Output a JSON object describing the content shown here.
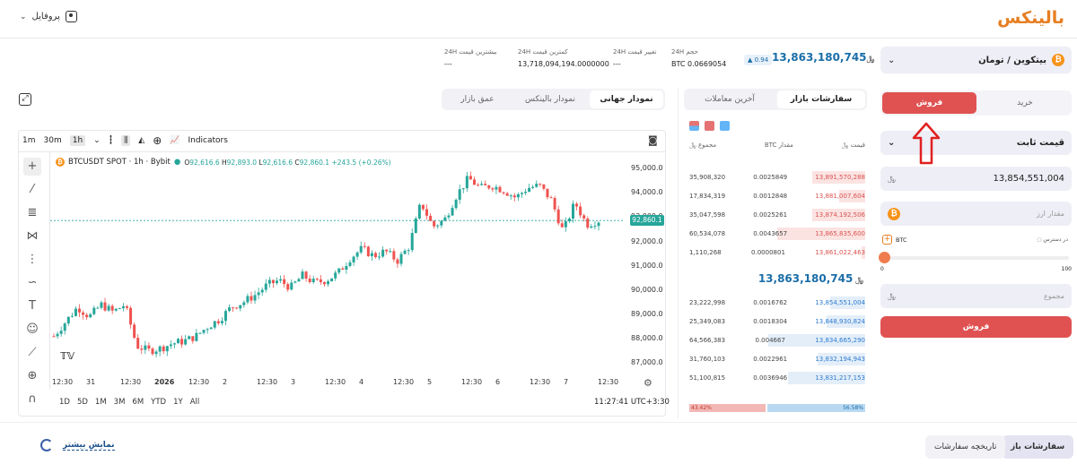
{
  "header": {
    "logo": "بالینکس",
    "profile": "پروفایل"
  },
  "colors": {
    "brand": "#e67e22",
    "sell": "#e05252",
    "buy_blue": "#2c7bd0",
    "positive": "#26a69a"
  },
  "market": {
    "pair": "بیتکوین / تومان",
    "last_price": "13,863,180,745",
    "change": "0.94",
    "stats": [
      {
        "label": "حجم 24H",
        "value": "BTC 0.0669054"
      },
      {
        "label": "تغییر قیمت 24H",
        "value": "---"
      },
      {
        "label": "کمترین قیمت 24H",
        "value": "13,718,094,194.0000000"
      },
      {
        "label": "بیشترین قیمت 24H",
        "value": "---"
      }
    ]
  },
  "trade": {
    "buy_tab": "خرید",
    "sell_tab": "فروش",
    "order_type": "قیمت ثابت",
    "price_value": "13,854,551,004",
    "amount_placeholder": "مقدار ارز",
    "available_label": "در دسترس",
    "asset": "BTC",
    "slider_min": "0",
    "slider_max": "100",
    "total_placeholder": "مجموع",
    "submit": "فروش"
  },
  "chart_tabs": [
    "نمودار جهانی",
    "نمودار بالینکس",
    "عمق بازار"
  ],
  "chart_toolbar": {
    "tf1": "1m",
    "tf2": "30m",
    "tf3": "1h",
    "indicators": "Indicators"
  },
  "chart_legend": {
    "symbol": "BTCUSDT SPOT · 1h · Bybit",
    "o": "92,616.6",
    "h": "92,893.0",
    "l": "92,616.6",
    "c": "92,860.1",
    "chg": "+243.5 (+0.26%)",
    "last_label": "92,860.1"
  },
  "chart_data": {
    "type": "candlestick",
    "title": "BTCUSDT SPOT · 1h · Bybit",
    "y_ticks": [
      "95,000.0",
      "94,000.0",
      "93,000.0",
      "92,000.0",
      "91,000.0",
      "90,000.0",
      "89,000.0",
      "88,000.0",
      "87,000.0"
    ],
    "ylim": [
      86600,
      95300
    ],
    "x_ticks": [
      "12:30",
      "31",
      "12:30",
      "2026",
      "12:30",
      "2",
      "12:30",
      "3",
      "12:30",
      "4",
      "12:30",
      "5",
      "12:30",
      "6",
      "12:30",
      "7",
      "12:30"
    ],
    "close_path": [
      88100,
      88700,
      89300,
      88900,
      89400,
      89100,
      89400,
      87700,
      87500,
      87600,
      87800,
      87900,
      88100,
      88500,
      88800,
      89300,
      89500,
      89800,
      90200,
      90400,
      90100,
      90600,
      90300,
      90400,
      90700,
      91300,
      91700,
      91400,
      91600,
      91200,
      91800,
      93600,
      92600,
      92900,
      93900,
      94600,
      94200,
      94300,
      94100,
      93800,
      94200,
      94300,
      93700,
      92400,
      93600,
      92700,
      92860
    ],
    "last_value": 92860.1
  },
  "chart_bottom": {
    "ranges": [
      "1D",
      "5D",
      "1M",
      "3M",
      "6M",
      "YTD",
      "1Y",
      "All"
    ],
    "time": "11:27:41 UTC+3:30"
  },
  "orderbook": {
    "tab_market": "سفارشات بازار",
    "tab_trades": "آخرین معاملات",
    "col_price": "قیمت",
    "col_amount": "مقدار",
    "col_amount_unit": "BTC",
    "col_total": "مجموع",
    "asks": [
      {
        "total": "35,908,320",
        "amount": "0.0025849",
        "price": "13,891,570,288",
        "fill": 0.3
      },
      {
        "total": "17,834,319",
        "amount": "0.0012848",
        "price": "13,881,007,604",
        "fill": 0.15
      },
      {
        "total": "35,047,598",
        "amount": "0.0025261",
        "price": "13,874,192,506",
        "fill": 0.3
      },
      {
        "total": "60,534,078",
        "amount": "0.0043657",
        "price": "13,865,835,600",
        "fill": 0.5
      },
      {
        "total": "1,110,268",
        "amount": "0.0000801",
        "price": "13,861,022,463",
        "fill": 0.02
      }
    ],
    "mid_price": "13,863,180,745",
    "bids": [
      {
        "total": "23,222,998",
        "amount": "0.0016762",
        "price": "13,854,551,004",
        "fill": 0.2
      },
      {
        "total": "25,349,083",
        "amount": "0.0018304",
        "price": "13,848,930,824",
        "fill": 0.22
      },
      {
        "total": "64,566,383",
        "amount": "0.004667",
        "price": "13,834,665,290",
        "fill": 0.55
      },
      {
        "total": "31,760,103",
        "amount": "0.0022961",
        "price": "13,832,194,943",
        "fill": 0.27
      },
      {
        "total": "51,100,815",
        "amount": "0.0036946",
        "price": "13,831,217,153",
        "fill": 0.44
      }
    ],
    "sell_pct": "43.42%",
    "buy_pct": "56.58%",
    "sell_ratio": 0.4342
  },
  "bottom": {
    "tab_open": "سفارشات باز",
    "tab_history": "تاریخچه سفارشات",
    "show_more": "نمایش بیشتر"
  }
}
